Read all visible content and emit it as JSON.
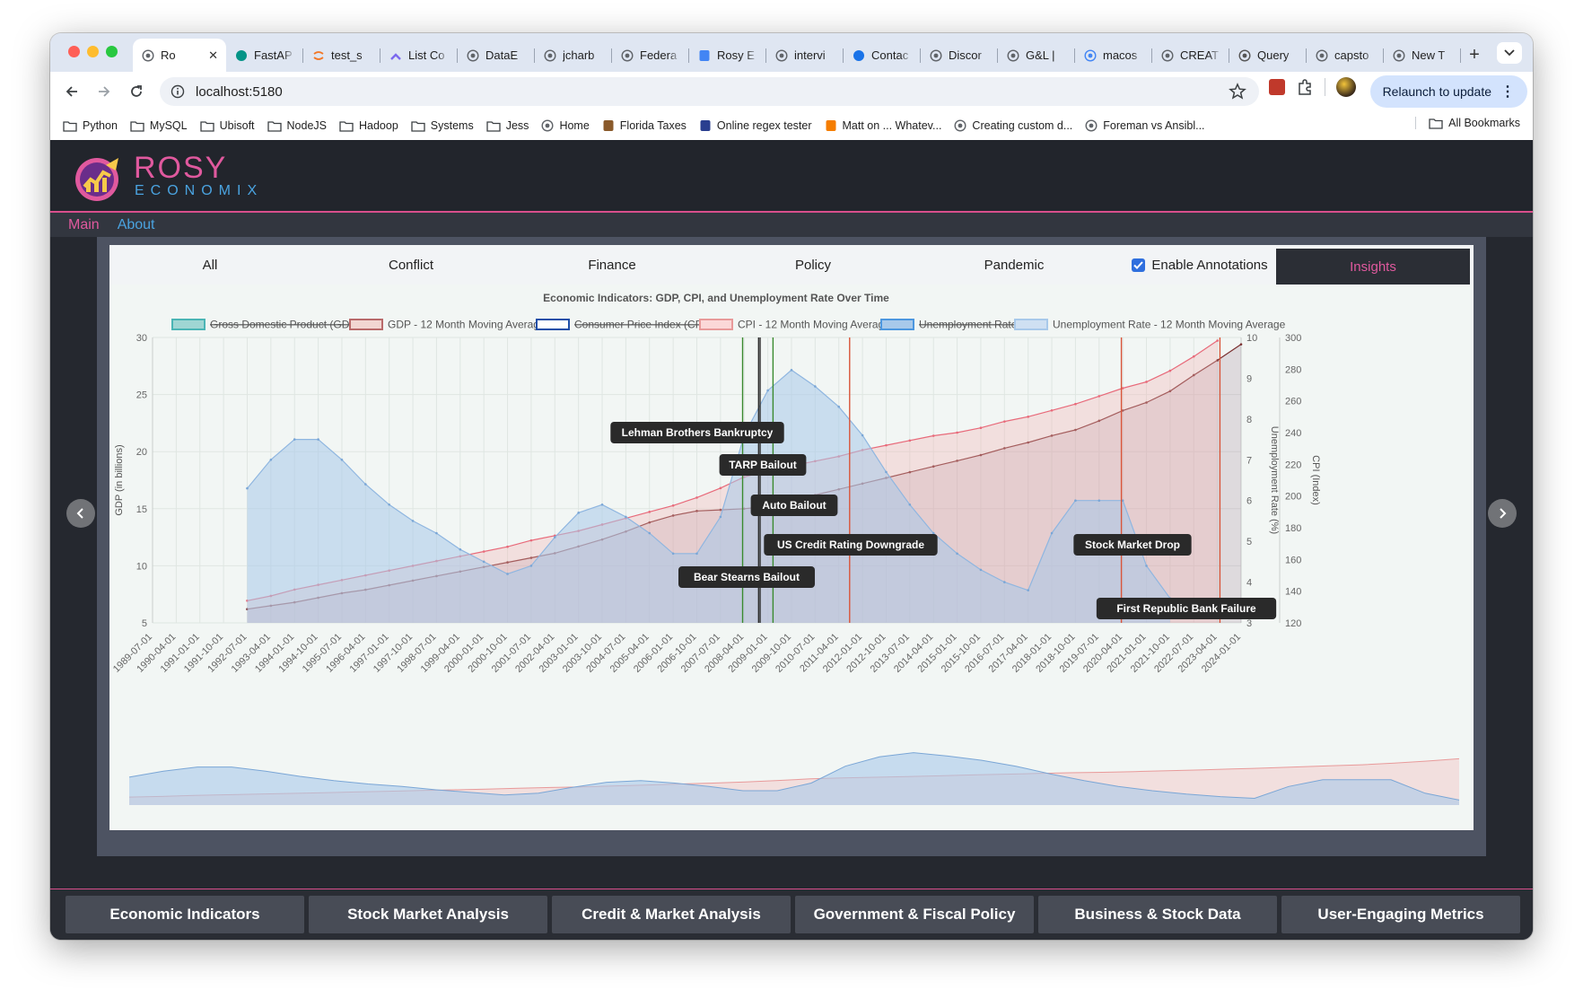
{
  "browser": {
    "tabs": [
      {
        "label": "Ro",
        "icon": "globe-icon",
        "active": true
      },
      {
        "label": "FastAP",
        "icon": "fastapi-icon"
      },
      {
        "label": "test_s",
        "icon": "jupyter-icon"
      },
      {
        "label": "List Co",
        "icon": "clickup-icon"
      },
      {
        "label": "DataE",
        "icon": "github-icon"
      },
      {
        "label": "jcharb",
        "icon": "github-icon"
      },
      {
        "label": "Federa",
        "icon": "globe-icon"
      },
      {
        "label": "Rosy E",
        "icon": "docs-icon"
      },
      {
        "label": "intervi",
        "icon": "globe-icon"
      },
      {
        "label": "Contac",
        "icon": "c-icon"
      },
      {
        "label": "Discor",
        "icon": "github-icon"
      },
      {
        "label": "G&L | ",
        "icon": "globe-icon"
      },
      {
        "label": "macos",
        "icon": "google-icon"
      },
      {
        "label": "CREAT",
        "icon": "globe-icon"
      },
      {
        "label": "Query",
        "icon": "bear-icon"
      },
      {
        "label": "capsto",
        "icon": "github-icon"
      },
      {
        "label": "New T",
        "icon": "chrome-icon"
      }
    ],
    "url": "localhost:5180",
    "relaunch_label": "Relaunch to update",
    "bookmarks": [
      {
        "label": "Python",
        "icon": "folder-icon"
      },
      {
        "label": "MySQL",
        "icon": "folder-icon"
      },
      {
        "label": "Ubisoft",
        "icon": "folder-icon"
      },
      {
        "label": "NodeJS",
        "icon": "folder-icon"
      },
      {
        "label": "Hadoop",
        "icon": "folder-icon"
      },
      {
        "label": "Systems",
        "icon": "folder-icon"
      },
      {
        "label": "Jess",
        "icon": "folder-icon"
      },
      {
        "label": "Home",
        "icon": "globe-icon"
      },
      {
        "label": "Florida Taxes",
        "icon": "site-icon"
      },
      {
        "label": "Online regex tester",
        "icon": "regex-icon"
      },
      {
        "label": "Matt on ... Whatev...",
        "icon": "blogger-icon"
      },
      {
        "label": "Creating custom d...",
        "icon": "globe-icon"
      },
      {
        "label": "Foreman vs Ansibl...",
        "icon": "globe-icon"
      }
    ],
    "all_bookmarks_label": "All Bookmarks"
  },
  "app": {
    "brand_line1": "ROSY",
    "brand_line2": "ECONOMIX",
    "nav": {
      "main": "Main",
      "about": "About"
    },
    "filters": [
      "All",
      "Conflict",
      "Finance",
      "Policy",
      "Pandemic"
    ],
    "annotations_label": "Enable Annotations",
    "annotations_enabled": true,
    "insights_label": "Insights",
    "carousel_count": 7,
    "carousel_active_index": 3,
    "bottom_nav": [
      "Economic Indicators",
      "Stock Market Analysis",
      "Credit & Market Analysis",
      "Government & Fiscal Policy",
      "Business & Stock Data",
      "User-Engaging Metrics"
    ]
  },
  "colors": {
    "accent_pink": "#e0599e",
    "accent_blue": "#4aa3e0",
    "gdp": "#4bb5b5",
    "gdp_ma": "#7a2f2f",
    "cpi": "#1f4fa8",
    "cpi_ma": "#e86a7a",
    "unemp": "#4d97df",
    "unemp_ma": "#a8c9ea"
  },
  "chart_data": {
    "type": "line",
    "title": "Economic Indicators: GDP, CPI, and Unemployment Rate Over Time",
    "legend_position": "top",
    "legend": [
      {
        "name": "Gross Domestic Product (GDP)",
        "hidden": true,
        "fill": "#9fd6d3",
        "stroke": "#4bb5b5"
      },
      {
        "name": "GDP - 12 Month Moving Average",
        "hidden": false,
        "fill": "#f2d6d2",
        "stroke": "#b96a6a"
      },
      {
        "name": "Consumer Price Index (CPI)",
        "hidden": true,
        "fill": "#ffffff",
        "stroke": "#1f4fa8"
      },
      {
        "name": "CPI - 12 Month Moving Average",
        "hidden": false,
        "fill": "#fbd8d8",
        "stroke": "#e89a9a"
      },
      {
        "name": "Unemployment Rate",
        "hidden": true,
        "fill": "#a8c9ea",
        "stroke": "#4d97df"
      },
      {
        "name": "Unemployment Rate - 12 Month Moving Average",
        "hidden": false,
        "fill": "#cfe0f2",
        "stroke": "#a8c9ea"
      }
    ],
    "y_left": {
      "label": "GDP (in billions)",
      "range": [
        5,
        30
      ],
      "ticks": [
        5,
        10,
        15,
        20,
        25,
        30
      ]
    },
    "y_right1": {
      "label": "Unemployment Rate (%)",
      "range": [
        3,
        10
      ],
      "ticks": [
        3,
        4,
        5,
        6,
        7,
        8,
        9,
        10
      ]
    },
    "y_right2": {
      "label": "CPI (Index)",
      "range": [
        120,
        300
      ],
      "ticks": [
        120,
        140,
        160,
        180,
        200,
        220,
        240,
        260,
        280,
        300
      ]
    },
    "x_ticks": [
      "1989-07-01",
      "1990-04-01",
      "1991-01-01",
      "1991-10-01",
      "1992-07-01",
      "1993-04-01",
      "1994-01-01",
      "1994-10-01",
      "1995-07-01",
      "1996-04-01",
      "1997-01-01",
      "1997-10-01",
      "1998-07-01",
      "1999-04-01",
      "2000-01-01",
      "2000-10-01",
      "2001-07-01",
      "2002-04-01",
      "2003-01-01",
      "2003-10-01",
      "2004-07-01",
      "2005-04-01",
      "2006-01-01",
      "2006-10-01",
      "2007-07-01",
      "2008-04-01",
      "2009-01-01",
      "2009-10-01",
      "2010-07-01",
      "2011-04-01",
      "2012-01-01",
      "2012-10-01",
      "2013-07-01",
      "2014-04-01",
      "2015-01-01",
      "2015-10-01",
      "2016-07-01",
      "2017-04-01",
      "2018-01-01",
      "2018-10-01",
      "2019-07-01",
      "2020-04-01",
      "2021-01-01",
      "2021-10-01",
      "2022-07-01",
      "2023-04-01",
      "2024-01-01"
    ],
    "series": [
      {
        "name": "GDP - 12 Month Moving Average",
        "axis": "y_left",
        "start_index": 4,
        "values": [
          6.2,
          6.5,
          6.8,
          7.2,
          7.6,
          7.9,
          8.3,
          8.7,
          9.1,
          9.5,
          9.9,
          10.3,
          10.7,
          11.1,
          11.7,
          12.3,
          13.0,
          13.8,
          14.4,
          14.8,
          14.9,
          15.0,
          15.2,
          15.7,
          16.2,
          16.7,
          17.2,
          17.7,
          18.2,
          18.7,
          19.2,
          19.7,
          20.3,
          20.8,
          21.4,
          21.9,
          22.7,
          23.6,
          24.3,
          25.3,
          26.7,
          28.0,
          29.4
        ]
      },
      {
        "name": "CPI - 12 Month Moving Average",
        "axis": "y_right2",
        "start_index": 4,
        "values": [
          134,
          137,
          141,
          144,
          147,
          150,
          153,
          156,
          159,
          162,
          165,
          168,
          172,
          175,
          178,
          182,
          186,
          190,
          194,
          199,
          205,
          212,
          216,
          219,
          222,
          225,
          229,
          232,
          235,
          238,
          240,
          243,
          247,
          250,
          254,
          258,
          263,
          268,
          272,
          279,
          288,
          298
        ]
      },
      {
        "name": "Unemployment Rate - 12 Month Moving Average",
        "axis": "y_right1",
        "start_index": 4,
        "values": [
          6.3,
          7.0,
          7.5,
          7.5,
          7.0,
          6.4,
          5.9,
          5.5,
          5.2,
          4.8,
          4.5,
          4.2,
          4.4,
          5.1,
          5.7,
          5.9,
          5.6,
          5.2,
          4.7,
          4.7,
          5.6,
          7.6,
          8.7,
          9.2,
          8.8,
          8.3,
          7.6,
          6.7,
          5.9,
          5.2,
          4.7,
          4.3,
          4.0,
          3.8,
          5.2,
          6.0,
          6.0,
          6.0,
          4.4,
          3.6
        ]
      }
    ],
    "annotations": [
      {
        "label": "Lehman Brothers Bankruptcy",
        "date": "2008-09-15",
        "color": "#2d2d2d"
      },
      {
        "label": "TARP Bailout",
        "date": "2008-10-03",
        "color": "#2d2d2d"
      },
      {
        "label": "Auto Bailout",
        "date": "2009-03-01",
        "color": "#3a8a2f"
      },
      {
        "label": "US Credit Rating Downgrade",
        "date": "2011-08-05",
        "color": "#d9553a"
      },
      {
        "label": "Bear Stearns Bailout",
        "date": "2008-03-14",
        "color": "#3a8a2f"
      },
      {
        "label": "Stock Market Drop",
        "date": "2020-03-16",
        "color": "#d9553a"
      },
      {
        "label": "First Republic Bank Failure",
        "date": "2023-05-01",
        "color": "#d9553a"
      }
    ]
  }
}
